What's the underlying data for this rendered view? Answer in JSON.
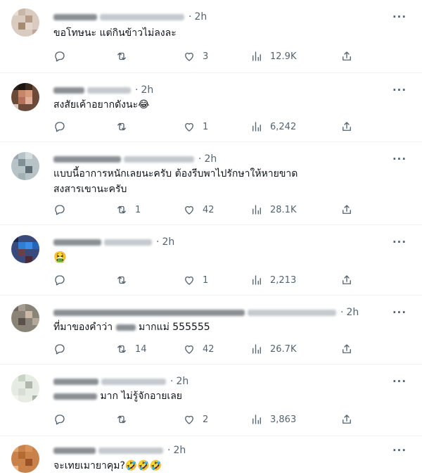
{
  "tweets": [
    {
      "time": "2h",
      "text": "ขอโทษนะ แต่กินข้าวไม่ลงละ",
      "replies": "",
      "retweets": "",
      "likes": "3",
      "views": "12.9K"
    },
    {
      "time": "2h",
      "text": "สงสัยเค้าอยากดังนะ😂",
      "replies": "",
      "retweets": "",
      "likes": "1",
      "views": "6,242"
    },
    {
      "time": "2h",
      "text_line1": "แบบนี้อาการหนักเลยนะครับ ต้องรีบพาไปรักษาให้หายขาด",
      "text_line2": "สงสารเขานะครับ",
      "replies": "",
      "retweets": "1",
      "likes": "42",
      "views": "28.1K"
    },
    {
      "time": "2h",
      "text": "🤮",
      "replies": "",
      "retweets": "",
      "likes": "1",
      "views": "2,213"
    },
    {
      "time": "2h",
      "text_pre": "ที่มาของคำว่า",
      "text_post": "มากแม่ 555555",
      "replies": "",
      "retweets": "14",
      "likes": "42",
      "views": "26.7K"
    },
    {
      "time": "2h",
      "text_post": "มาก ไม่รู้จักอายเลย",
      "replies": "",
      "retweets": "",
      "likes": "2",
      "views": "3,863"
    },
    {
      "time": "2h",
      "text": "จะเทยเมายาคุม?🤣🤣🤣",
      "replies": "",
      "retweets": "",
      "likes": "",
      "views": ""
    }
  ],
  "icons": {
    "more": "more-horizontal-icon",
    "reply": "reply-icon",
    "retweet": "retweet-icon",
    "like": "heart-icon",
    "views": "views-icon",
    "share": "share-icon"
  },
  "colors": {
    "text": "#0f1419",
    "secondary": "#536471",
    "divider": "#eff3f4"
  }
}
